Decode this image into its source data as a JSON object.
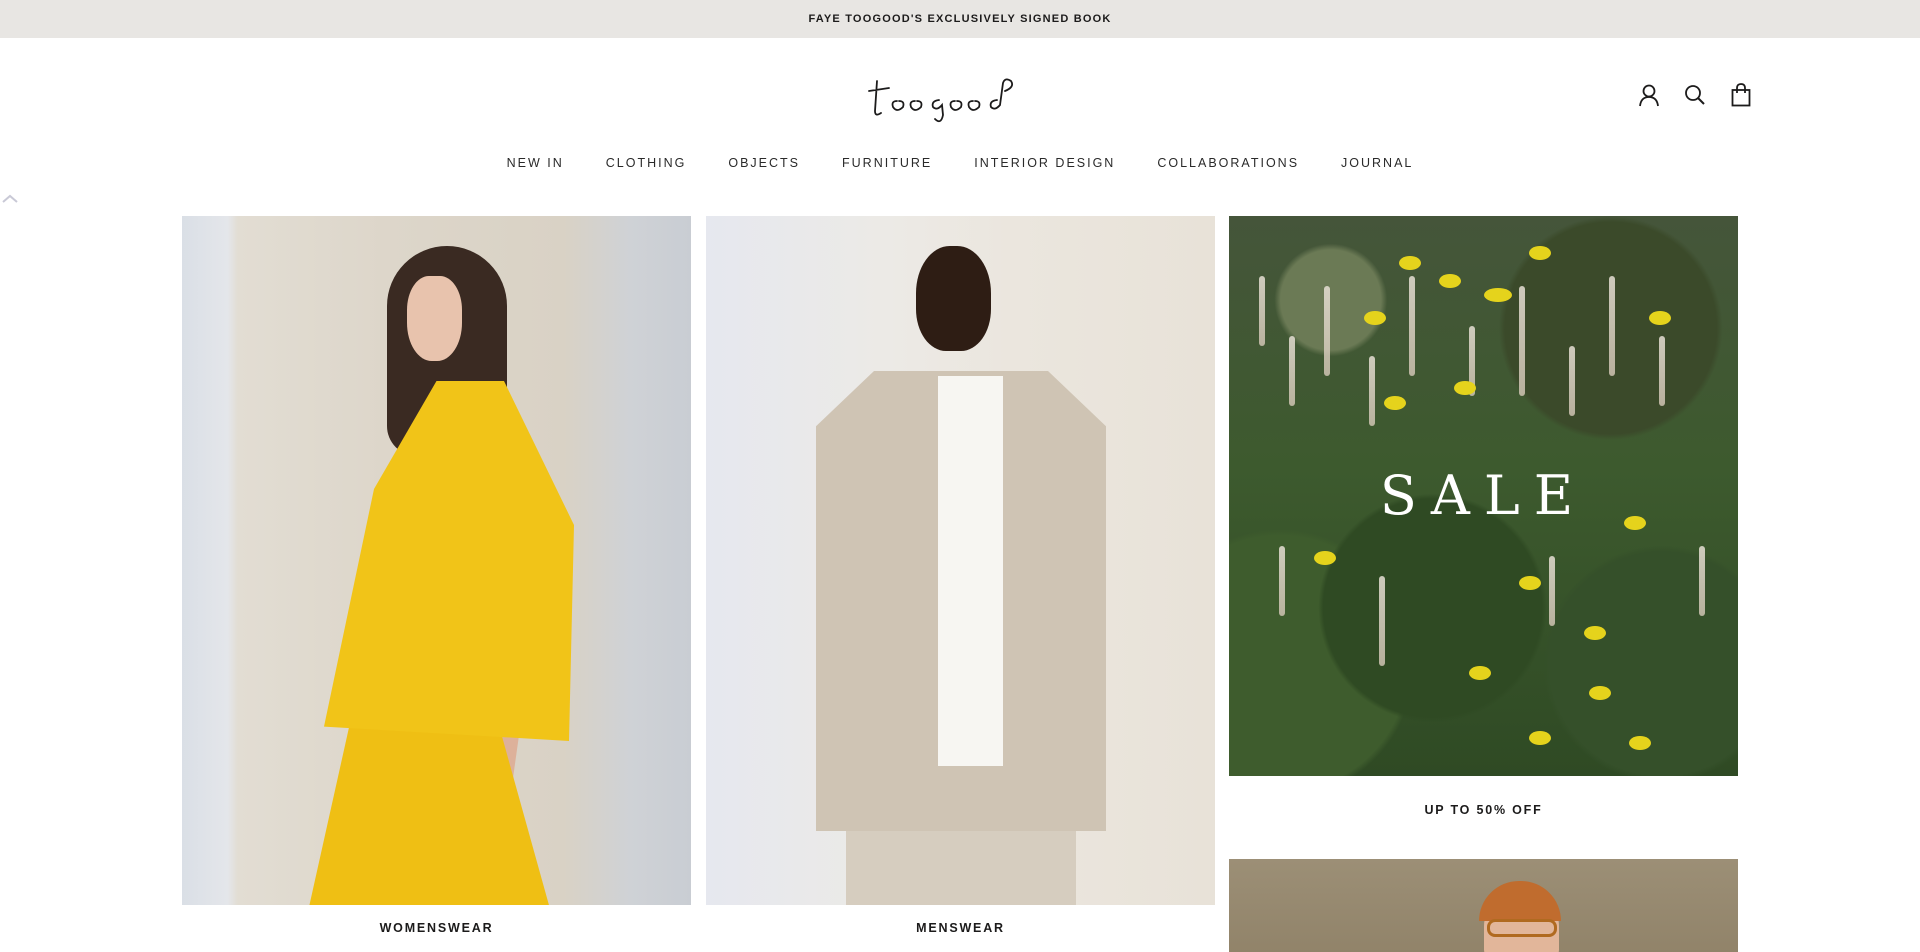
{
  "announcement": {
    "text": "FAYE TOOGOOD'S EXCLUSIVELY SIGNED BOOK"
  },
  "brand": {
    "logo_text": "toogood"
  },
  "header_icons": [
    "account-icon",
    "search-icon",
    "cart-icon"
  ],
  "nav": {
    "items": [
      {
        "label": "NEW IN"
      },
      {
        "label": "CLOTHING"
      },
      {
        "label": "OBJECTS"
      },
      {
        "label": "FURNITURE"
      },
      {
        "label": "INTERIOR DESIGN"
      },
      {
        "label": "COLLABORATIONS"
      },
      {
        "label": "JOURNAL"
      }
    ]
  },
  "tiles": {
    "women": {
      "caption": "WOMENSWEAR"
    },
    "men": {
      "caption": "MENSWEAR"
    },
    "sale": {
      "title": "SALE",
      "caption": "UP TO 50% OFF"
    }
  },
  "colors": {
    "announcement_bg": "#e8e6e3",
    "text": "#1c1b1b",
    "accent_yellow": "#f1c418"
  }
}
